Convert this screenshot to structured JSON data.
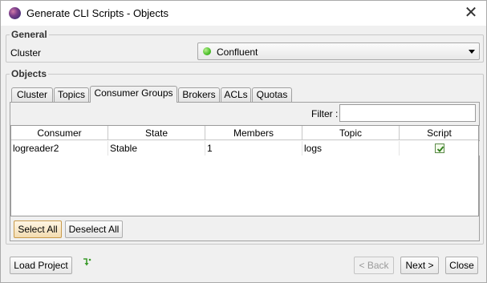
{
  "window": {
    "title": "Generate CLI Scripts - Objects",
    "close_symbol": "✕"
  },
  "general": {
    "label": "General",
    "cluster_label": "Cluster",
    "cluster_value": "Confluent",
    "cluster_status_color": "#4cbf2a"
  },
  "objects": {
    "label": "Objects",
    "tabs": [
      {
        "label": "Cluster",
        "active": false
      },
      {
        "label": "Topics",
        "active": false
      },
      {
        "label": "Consumer Groups",
        "active": true
      },
      {
        "label": "Brokers",
        "active": false
      },
      {
        "label": "ACLs",
        "active": false
      },
      {
        "label": "Quotas",
        "active": false
      }
    ],
    "filter_label": "Filter :",
    "filter_value": "",
    "columns": [
      "Consumer",
      "State",
      "Members",
      "Topic",
      "Script"
    ],
    "rows": [
      {
        "consumer": "logreader2",
        "state": "Stable",
        "members": "1",
        "topic": "logs",
        "script_checked": true
      }
    ],
    "select_all_label": "Select All",
    "deselect_all_label": "Deselect All"
  },
  "footer": {
    "load_project_label": "Load Project",
    "import_icon": "green-arrow-down-icon",
    "back_label": "< Back",
    "next_label": "Next >",
    "close_label": "Close"
  }
}
